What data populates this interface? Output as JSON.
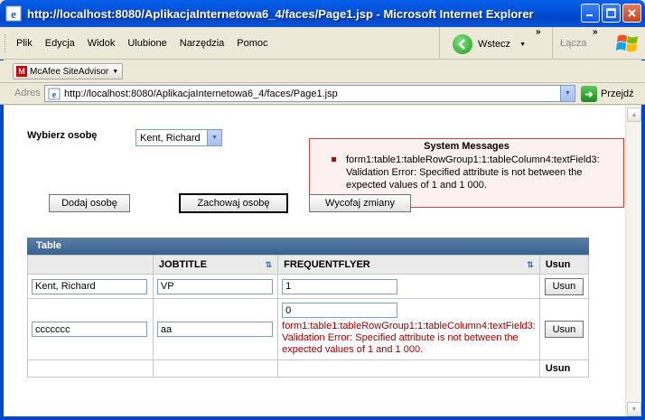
{
  "window": {
    "title": "http://localhost:8080/AplikacjaInternetowa6_4/faces/Page1.jsp - Microsoft Internet Explorer"
  },
  "menu": {
    "items": [
      "Plik",
      "Edycja",
      "Widok",
      "Ulubione",
      "Narzędzia",
      "Pomoc"
    ]
  },
  "toolbar": {
    "back_label": "Wstecz",
    "links_label": "Łącza",
    "overflow": "»"
  },
  "mcafee": {
    "label": "McAfee SiteAdvisor"
  },
  "address": {
    "label": "Adres",
    "url": "http://localhost:8080/AplikacjaInternetowa6_4/faces/Page1.jsp",
    "go_label": "Przejdź"
  },
  "form": {
    "select_label": "Wybierz osobę",
    "selected_person": "Kent, Richard",
    "buttons": {
      "add": "Dodaj osobę",
      "save": "Zachowaj osobę",
      "revert": "Wycofaj zmiany"
    }
  },
  "system_messages": {
    "title": "System Messages",
    "items": [
      "form1:table1:tableRowGroup1:1:tableColumn4:textField3: Validation Error: Specified attribute is not between the expected values of 1 and 1 000."
    ]
  },
  "table": {
    "title": "Table",
    "columns": [
      "",
      "JOBTITLE",
      "FREQUENTFLYER",
      "Usun"
    ],
    "rows": [
      {
        "name": "Kent, Richard",
        "jobtitle": "VP",
        "frequentflyer": "1",
        "error": "",
        "action": "Usun"
      },
      {
        "name": "ccccccc",
        "jobtitle": "aa",
        "frequentflyer": "0",
        "error": "form1:table1:tableRowGroup1:1:tableColumn4:textField3: Validation Error: Specified attribute is not between the expected values of 1 and 1 000.",
        "action": "Usun"
      }
    ],
    "footer": {
      "usun": "Usun"
    }
  },
  "colors": {
    "title_bar": "#0046c8",
    "table_header": "#3a6290",
    "error_text": "#a00000",
    "message_border": "#c0473f"
  }
}
